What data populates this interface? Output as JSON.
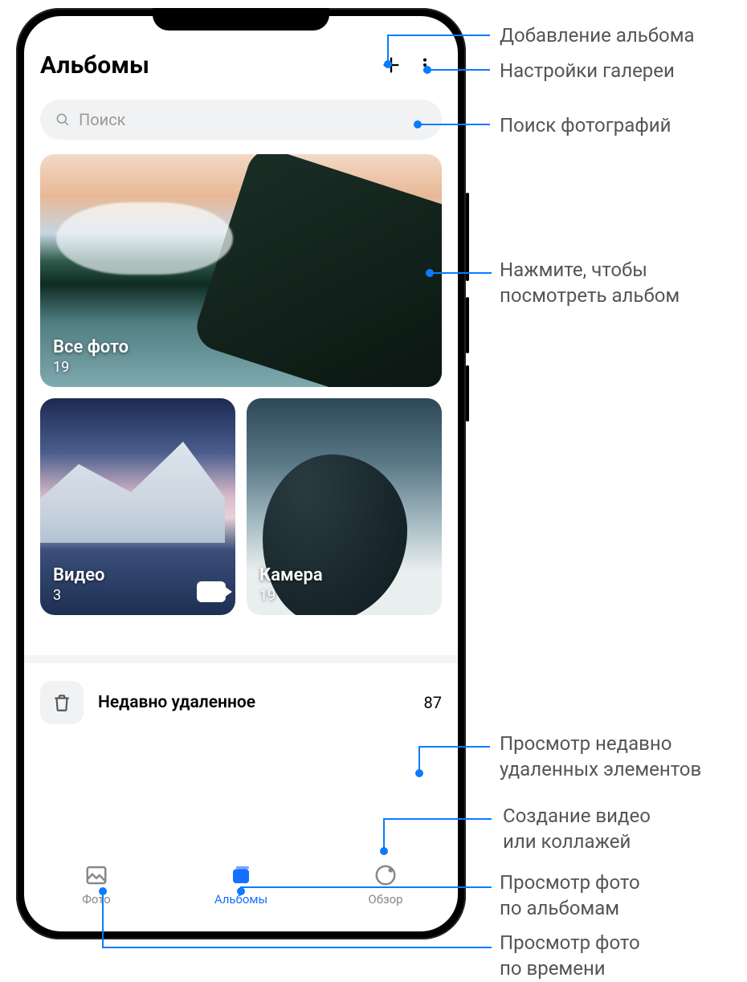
{
  "header": {
    "title": "Альбомы"
  },
  "search": {
    "placeholder": "Поиск"
  },
  "albums": {
    "all": {
      "name": "Все фото",
      "count": "19"
    },
    "video": {
      "name": "Видео",
      "count": "3"
    },
    "camera": {
      "name": "Камера",
      "count": "19"
    }
  },
  "deleted": {
    "label": "Недавно удаленное",
    "count": "87"
  },
  "tabs": {
    "photo": "Фото",
    "albums": "Альбомы",
    "discover": "Обзор"
  },
  "callouts": {
    "add_album": "Добавление альбома",
    "settings": "Настройки галереи",
    "search": "Поиск фотографий",
    "tap_album": "Нажмите, чтобы\nпосмотреть альбом",
    "recently_deleted": "Просмотр недавно\nудаленных элементов",
    "create": "Создание видео\nили коллажей",
    "by_albums": "Просмотр фото\nпо альбомам",
    "by_time": "Просмотр фото\nпо времени"
  },
  "colors": {
    "accent": "#1670ff",
    "callout": "#0b7bff"
  }
}
